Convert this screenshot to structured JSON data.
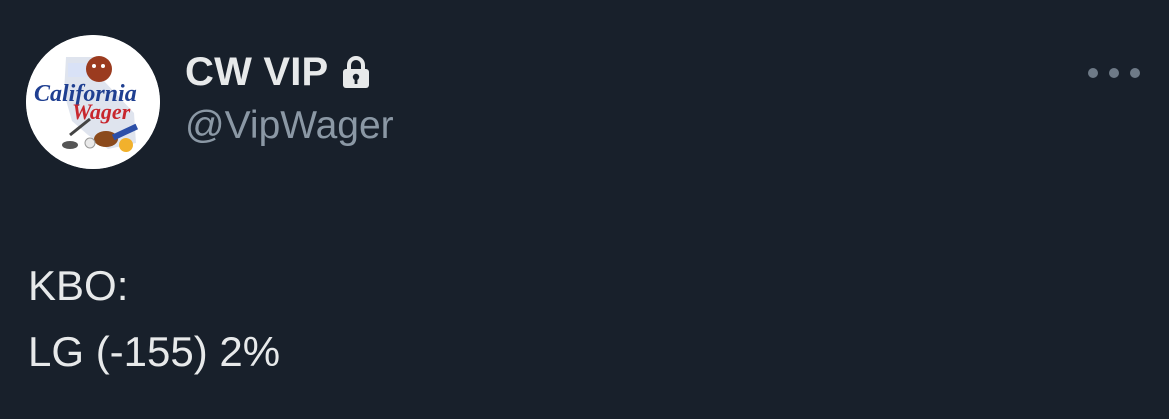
{
  "tweet": {
    "author": {
      "display_name": "CW VIP",
      "handle": "@VipWager",
      "verified_icon": "lock-icon",
      "avatar_logo_text": "California Wager"
    },
    "more_icon": "more-horizontal-icon",
    "body_lines": [
      "KBO:",
      "LG (-155) 2%"
    ]
  },
  "colors": {
    "background": "#18202b",
    "text_primary": "#e7e9ea",
    "text_secondary": "#8b98a5",
    "logo_red": "#c8262d",
    "logo_blue": "#1f3f91"
  }
}
